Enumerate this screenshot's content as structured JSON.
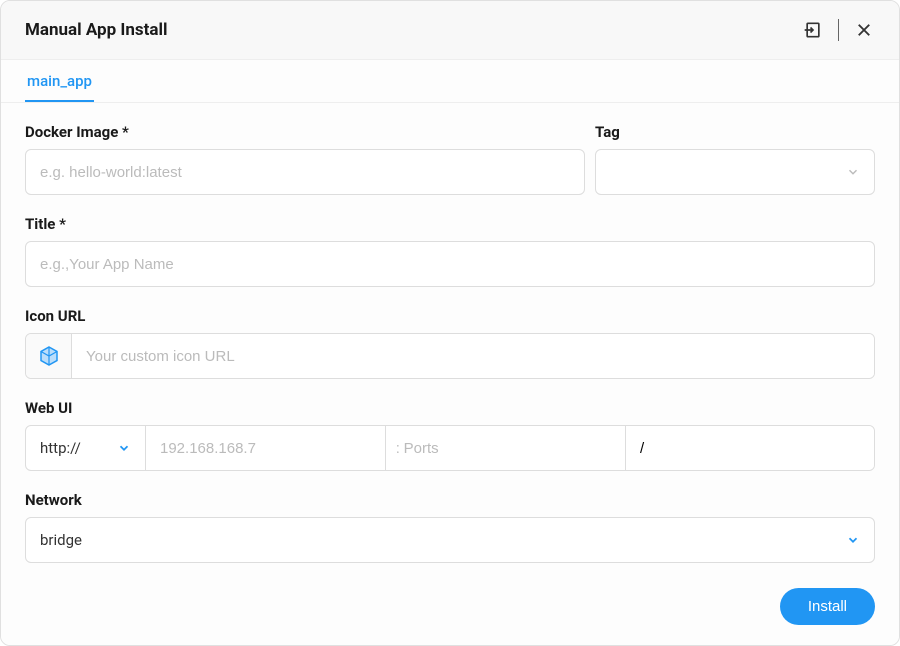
{
  "header": {
    "title": "Manual App Install"
  },
  "tabs": {
    "main": "main_app"
  },
  "form": {
    "docker_image": {
      "label": "Docker Image *",
      "placeholder": "e.g. hello-world:latest",
      "value": ""
    },
    "tag": {
      "label": "Tag",
      "value": ""
    },
    "title": {
      "label": "Title *",
      "placeholder": "e.g.,Your App Name",
      "value": ""
    },
    "icon_url": {
      "label": "Icon URL",
      "placeholder": "Your custom icon URL",
      "value": ""
    },
    "web_ui": {
      "label": "Web UI",
      "protocol": "http://",
      "host_placeholder": "192.168.168.7",
      "host_value": "",
      "ports_prefix": ":",
      "ports_placeholder": "Ports",
      "ports_value": "",
      "path_value": "/"
    },
    "network": {
      "label": "Network",
      "value": "bridge"
    }
  },
  "footer": {
    "install_label": "Install"
  }
}
